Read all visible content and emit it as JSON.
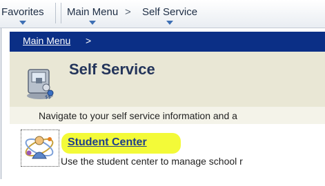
{
  "menubar": {
    "favorites": "Favorites",
    "main_menu": "Main Menu",
    "separator": ">",
    "self_service": "Self Service"
  },
  "breadcrumb": {
    "link": "Main Menu",
    "separator": ">"
  },
  "header": {
    "title": "Self Service",
    "icon": "self-service-computer-icon",
    "description": "Navigate to your self service information and a"
  },
  "items": [
    {
      "label": "Student Center",
      "description": "Use the student center to manage school r",
      "icon": "student-center-icon",
      "highlight_color": "#f3fa38"
    }
  ],
  "colors": {
    "breadcrumb_bar": "#0b2f86",
    "header_band": "#e9e7d5",
    "link": "#1f3f8a"
  }
}
